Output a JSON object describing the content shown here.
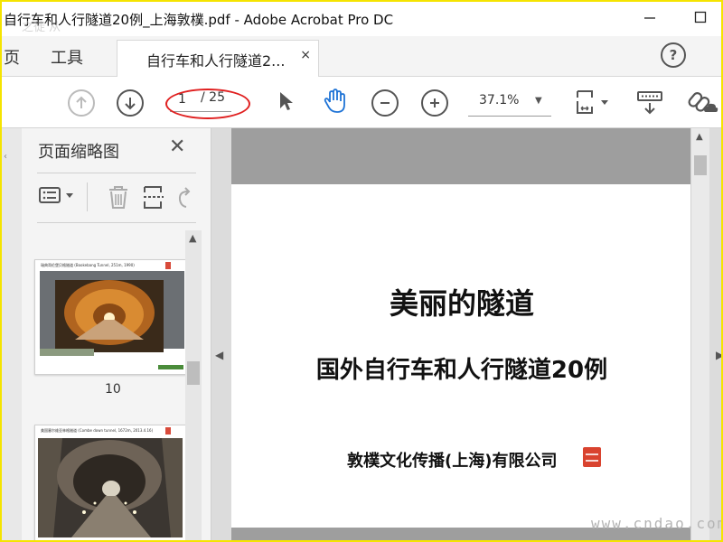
{
  "window": {
    "title": "自行车和人行隧道20例_上海敦樸.pdf - Adobe Acrobat Pro DC",
    "ghost_overlay": "之徒 从"
  },
  "menu": {
    "home_label": "页",
    "tools_label": "工具"
  },
  "document_tab": {
    "label": "自行车和人行隧道2...",
    "close": "×"
  },
  "toolbar": {
    "page_current": "1",
    "page_total": "/ 25",
    "zoom": "37.1%"
  },
  "thumbnails_panel": {
    "title": "页面缩略图",
    "close": "✕",
    "pages": [
      {
        "number": "10",
        "caption": "瑞典哥伦堡贝格隧道 (Bookebang Tunnel, 251m, 1990)"
      },
      {
        "number": "",
        "caption": "美国塞尔维亚林格隧道 (Combe down tunnel, 1672m, 2013.4.16)"
      }
    ]
  },
  "document": {
    "title": "美丽的隧道",
    "subtitle": "国外自行车和人行隧道20例",
    "company": "敦樸文化传播(上海)有限公司"
  },
  "watermark": "www.cndao.com",
  "colors": {
    "frame": "#f5e400",
    "annotation": "#e02020",
    "page_gray": "#9e9e9e",
    "hand_tool": "#1e73d6"
  }
}
